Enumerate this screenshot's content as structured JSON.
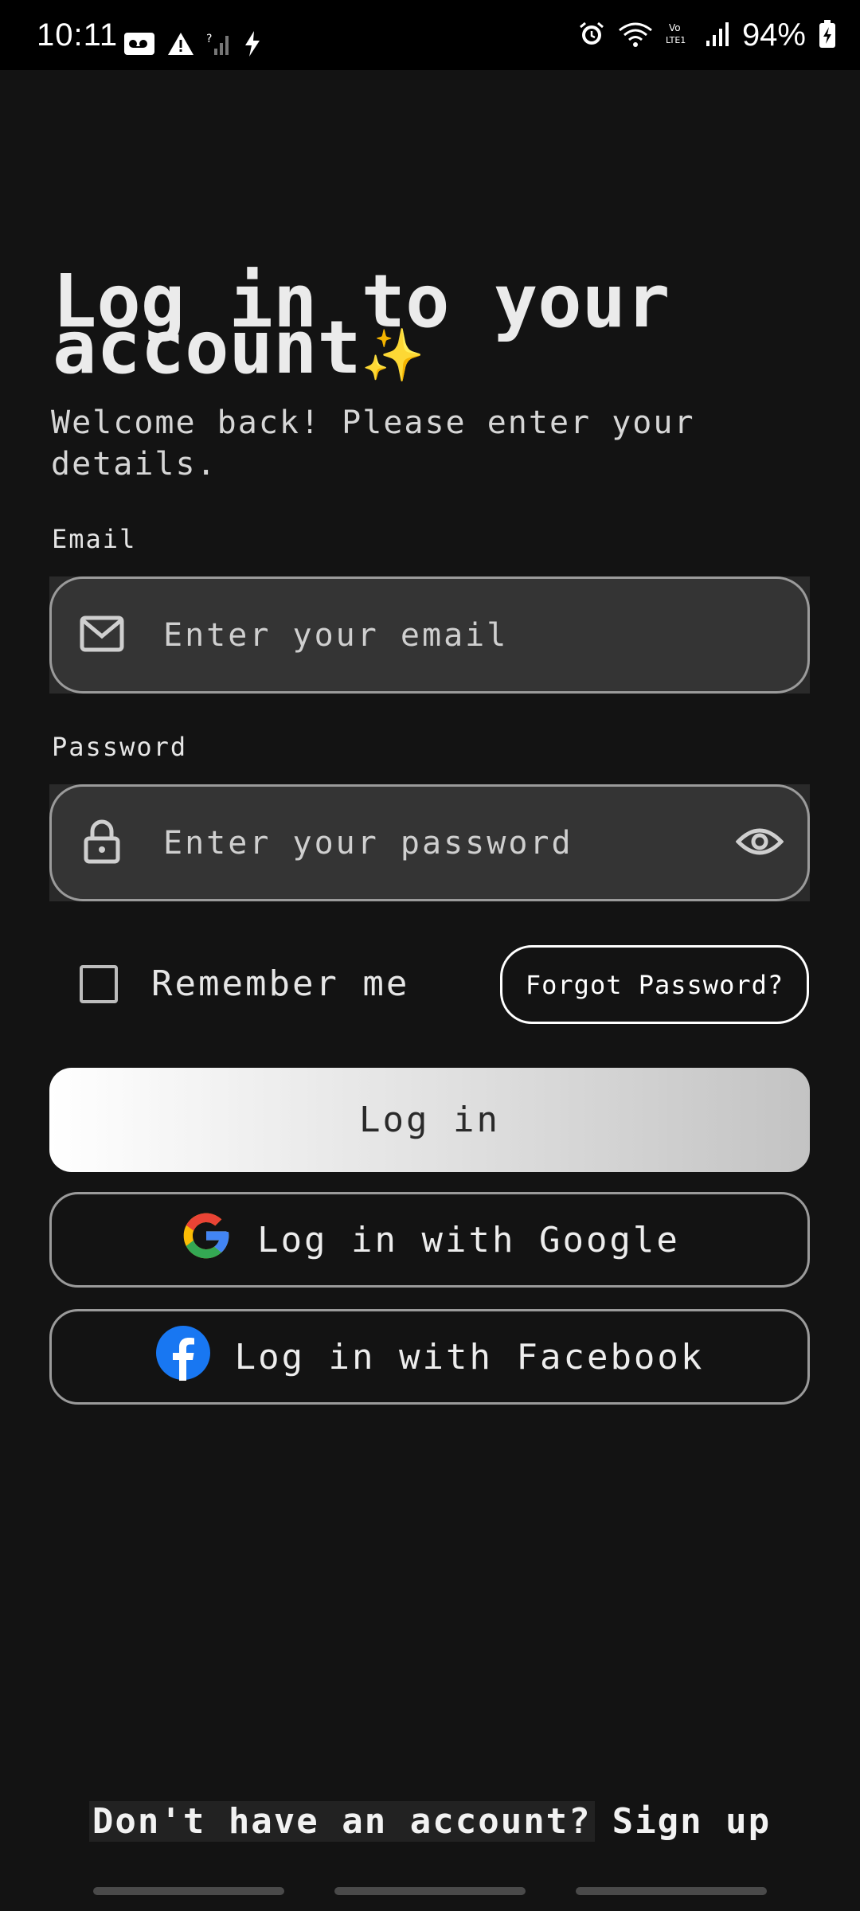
{
  "status_bar": {
    "time": "10:11",
    "battery_percent": "94%",
    "icons_left": [
      "voicemail-icon",
      "warning-icon",
      "no-signal-icon",
      "charging-icon"
    ],
    "icons_right": [
      "alarm-icon",
      "wifi-icon",
      "volte-icon",
      "signal-icon",
      "battery-icon"
    ]
  },
  "header": {
    "title": "Log in to your account",
    "title_emoji": "✨",
    "subtitle": "Welcome back! Please enter your details."
  },
  "form": {
    "email_label": "Email",
    "email_placeholder": "Enter your email",
    "password_label": "Password",
    "password_placeholder": "Enter your password",
    "remember_label": "Remember me",
    "remember_checked": false,
    "forgot_label": "Forgot Password?"
  },
  "actions": {
    "login_label": "Log in",
    "google_label": "Log in with Google",
    "facebook_label": "Log in with Facebook"
  },
  "footer": {
    "question": "Don't have an account?",
    "signup_label": "Sign up"
  },
  "colors": {
    "background": "#131313",
    "field_bg": "#343434",
    "google_blue": "#4285F4",
    "google_red": "#EA4335",
    "google_yellow": "#FBBC05",
    "google_green": "#34A853",
    "facebook_blue": "#1877F2"
  }
}
